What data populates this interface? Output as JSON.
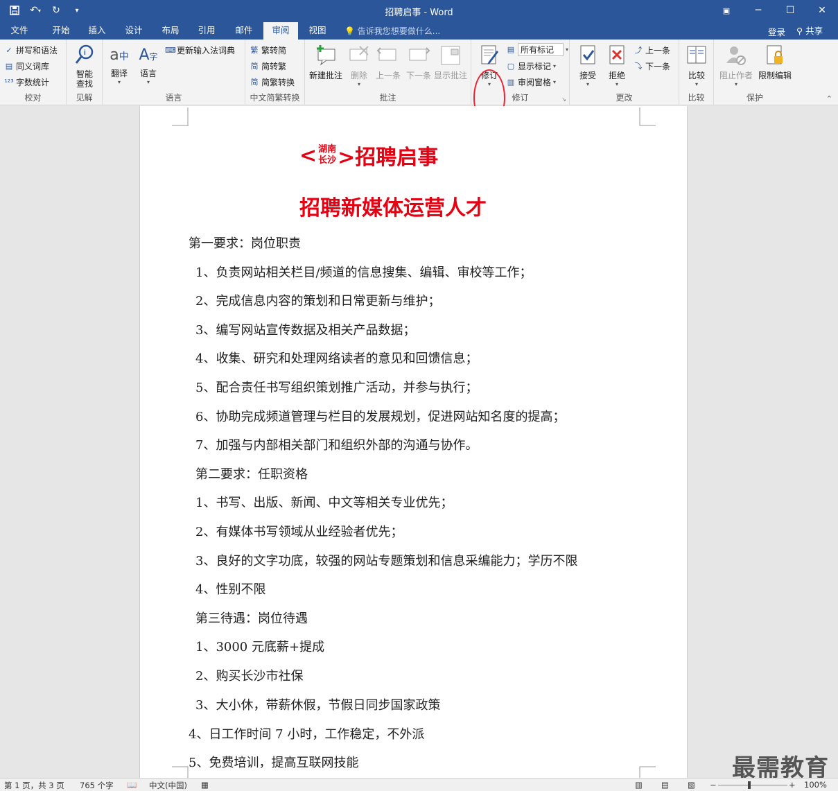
{
  "app": {
    "title": "招聘启事 - Word",
    "qat_icons": [
      "save-icon",
      "undo-icon",
      "redo-icon",
      "customize-icon"
    ],
    "window_controls": [
      "ribbon-display-icon",
      "minimize-icon",
      "maximize-icon",
      "close-icon"
    ]
  },
  "tabs": [
    "文件",
    "开始",
    "插入",
    "设计",
    "布局",
    "引用",
    "邮件",
    "审阅",
    "视图"
  ],
  "active_tab": "审阅",
  "tellme": "告诉我您想要做什么...",
  "login": "登录",
  "share": "共享",
  "ribbon": {
    "proofing": {
      "label": "校对",
      "items": [
        "拼写和语法",
        "同义词库",
        "字数统计"
      ]
    },
    "insights": {
      "label": "见解",
      "smart_lookup": "智能\n查找"
    },
    "language": {
      "label": "语言",
      "translate": "翻译",
      "language": "语言",
      "update_ime": "更新输入法词典"
    },
    "chinese_conv": {
      "label": "中文简繁转换",
      "items": [
        "繁转简",
        "简转繁",
        "简繁转换"
      ]
    },
    "comments": {
      "label": "批注",
      "items": [
        "新建批注",
        "删除",
        "上一条",
        "下一条",
        "显示批注"
      ]
    },
    "tracking": {
      "label": "修订",
      "track": "修订",
      "markup_select": "所有标记",
      "show_markup": "显示标记",
      "review_pane": "审阅窗格"
    },
    "changes": {
      "label": "更改",
      "accept": "接受",
      "reject": "拒绝",
      "prev": "上一条",
      "next": "下一条"
    },
    "compare": {
      "label": "比较",
      "compare": "比较"
    },
    "protect": {
      "label": "保护",
      "block_authors": "阻止作者",
      "restrict": "限制编辑"
    }
  },
  "document": {
    "title_prefix": "<",
    "title_top": "湖南",
    "title_bottom": "长沙",
    "title_suffix": ">招聘启事",
    "subtitle": "招聘新媒体运营人才",
    "lines": [
      "第一要求：岗位职责",
      "1、负责网站相关栏目/频道的信息搜集、编辑、审校等工作；",
      "2、完成信息内容的策划和日常更新与维护；",
      "3、编写网站宣传数据及相关产品数据；",
      "4、收集、研究和处理网络读者的意见和回馈信息；",
      "5、配合责任书写组织策划推广活动，并参与执行；",
      "6、协助完成频道管理与栏目的发展规划，促进网站知名度的提高；",
      "7、加强与内部相关部门和组织外部的沟通与协作。",
      "第二要求：任职资格",
      "1、书写、出版、新闻、中文等相关专业优先；",
      "2、有媒体书写领域从业经验者优先；",
      "3、良好的文字功底，较强的网站专题策划和信息采编能力；学历不限",
      "4、性别不限",
      "第三待遇：岗位待遇",
      "1、3000 元底薪+提成",
      "2、购买长沙市社保",
      "3、大小休，带薪休假，节假日同步国家政策",
      "4、日工作时间 7 小时，工作稳定，不外派",
      "5、免费培训，提高互联网技能"
    ]
  },
  "status": {
    "page": "第 1 页，共 3 页",
    "words": "765 个字",
    "lang": "中文(中国)",
    "zoom": "100%",
    "zoom_level": 1.0
  },
  "watermark": "最需教育",
  "colors": {
    "accent": "#2b579a",
    "title_red": "#e60012"
  }
}
